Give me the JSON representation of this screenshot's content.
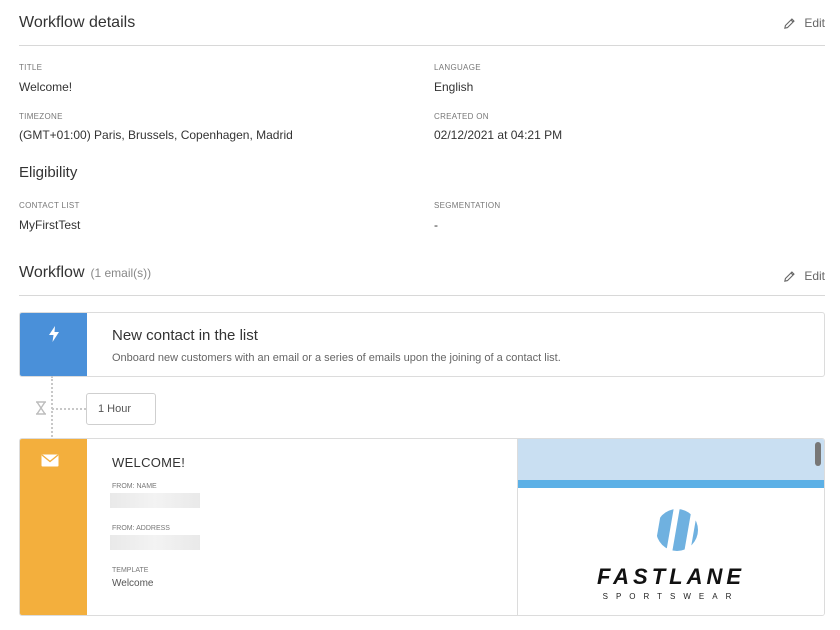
{
  "details": {
    "title": "Workflow details",
    "edit_label": "Edit",
    "fields": {
      "title_label": "TITLE",
      "title_value": "Welcome!",
      "language_label": "LANGUAGE",
      "language_value": "English",
      "timezone_label": "TIMEZONE",
      "timezone_value": "(GMT+01:00) Paris, Brussels, Copenhagen, Madrid",
      "created_label": "CREATED ON",
      "created_value": "02/12/2021 at 04:21 PM"
    }
  },
  "eligibility": {
    "title": "Eligibility",
    "contact_list_label": "CONTACT LIST",
    "contact_list_value": "MyFirstTest",
    "segmentation_label": "SEGMENTATION",
    "segmentation_value": "-"
  },
  "workflow": {
    "title": "Workflow",
    "count": "(1 email(s))",
    "edit_label": "Edit",
    "trigger": {
      "icon": "lightning-icon",
      "color": "#4a90d9",
      "title": "New contact in the list",
      "description": "Onboard new customers with an email or a series of emails upon the joining of a contact list."
    },
    "delay": {
      "icon": "hourglass-icon",
      "value": "1 Hour"
    },
    "email": {
      "icon": "envelope-icon",
      "color": "#f3af3d",
      "title": "WELCOME!",
      "from_name_label": "FROM: NAME",
      "from_address_label": "FROM: ADDRESS",
      "template_label": "TEMPLATE",
      "template_value": "Welcome",
      "preview": {
        "brand": "FASTLANE",
        "tagline": "SPORTSWEAR",
        "brand_color": "#6fb1e0"
      }
    }
  }
}
